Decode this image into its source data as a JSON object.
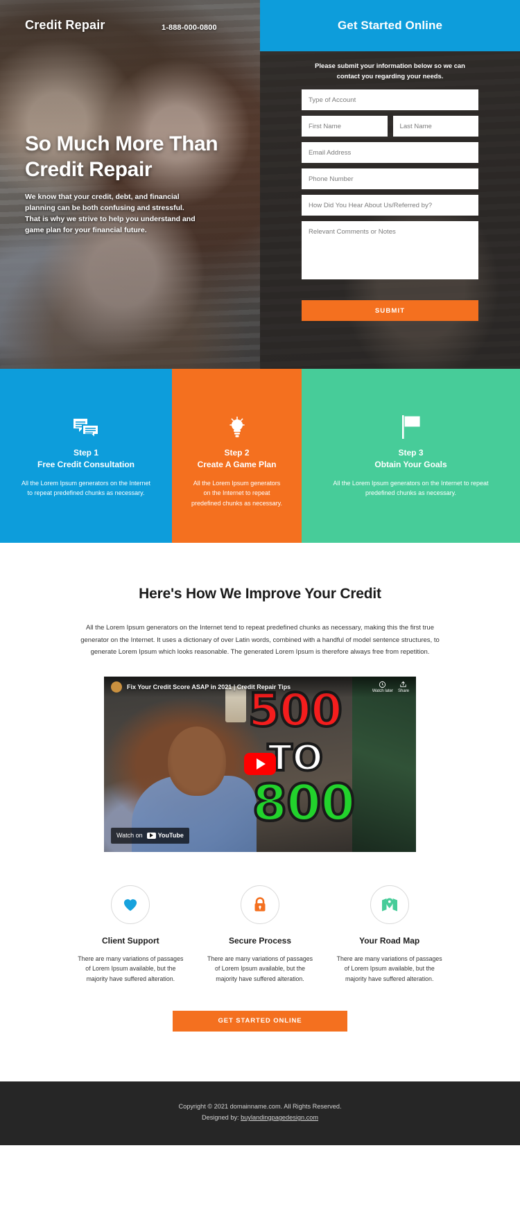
{
  "hero": {
    "brand": "Credit Repair",
    "phone": "1-888-000-0800",
    "title_line1": "So Much More Than",
    "title_line2": "Credit Repair",
    "subtext": "We know that your credit, debt, and financial planning can be both confusing and stressful. That is why we strive to help you understand and game plan for your financial future."
  },
  "form": {
    "heading": "Get Started Online",
    "note": "Please submit your information below so we can contact you regarding your needs.",
    "fields": [
      {
        "name": "account-type",
        "placeholder": "Type of Account",
        "value": ""
      },
      {
        "name": "first-name",
        "placeholder": "First Name",
        "value": ""
      },
      {
        "name": "last-name",
        "placeholder": "Last Name",
        "value": ""
      },
      {
        "name": "email",
        "placeholder": "Email Address",
        "value": ""
      },
      {
        "name": "phone",
        "placeholder": "Phone Number",
        "value": ""
      },
      {
        "name": "referral",
        "placeholder": "How Did You Hear About Us/Referred by?",
        "value": ""
      },
      {
        "name": "comments",
        "placeholder": "Relevant Comments or Notes",
        "value": ""
      }
    ],
    "submit_label": "SUBMIT",
    "header_color": "#0d9ddb",
    "submit_color": "#f4701f"
  },
  "steps": [
    {
      "icon": "chat-bubbles-icon",
      "number": "Step 1",
      "title": "Free Credit Consultation",
      "desc": "All the Lorem Ipsum generators on the Internet to repeat predefined chunks as necessary.",
      "color": "#0d9ddb"
    },
    {
      "icon": "lightbulb-icon",
      "number": "Step 2",
      "title": "Create A Game Plan",
      "desc": "All the Lorem Ipsum generators on the Internet to repeat predefined chunks as necessary.",
      "color": "#f4701f"
    },
    {
      "icon": "flag-icon",
      "number": "Step 3",
      "title": "Obtain Your Goals",
      "desc": "All the Lorem Ipsum generators on the Internet to repeat predefined chunks as necessary.",
      "color": "#47cc99"
    }
  ],
  "improve": {
    "heading": "Here's How We Improve Your Credit",
    "paragraph": "All the Lorem Ipsum generators on the Internet tend to repeat predefined chunks as necessary, making this the first true generator on the Internet. It uses a dictionary of over Latin words, combined with a handful of model sentence structures, to generate Lorem Ipsum which looks reasonable. The generated Lorem Ipsum is therefore always free from repetition."
  },
  "video": {
    "title": "Fix Your Credit Score ASAP in 2021 | Credit Repair Tips",
    "watch_later": "Watch later",
    "share": "Share",
    "watch_on": "Watch on",
    "provider": "YouTube",
    "big_text_1": "500",
    "big_text_2": "TO",
    "big_text_3": "800"
  },
  "features": [
    {
      "icon": "heart-icon",
      "title": "Client Support",
      "desc": "There are many variations of passages of Lorem Ipsum available, but the majority have suffered alteration.",
      "color": "#17a2dd"
    },
    {
      "icon": "lock-icon",
      "title": "Secure Process",
      "desc": "There are many variations of passages of Lorem Ipsum available, but the majority have suffered alteration.",
      "color": "#f4701f"
    },
    {
      "icon": "map-pin-icon",
      "title": "Your Road Map",
      "desc": "There are many variations of passages of Lorem Ipsum available, but the majority have suffered alteration.",
      "color": "#47cc99"
    }
  ],
  "cta": {
    "label": "GET STARTED ONLINE"
  },
  "footer": {
    "line1": "Copyright © 2021 domainname.com. All Rights Reserved.",
    "line2_prefix": "Designed by: ",
    "line2_link": "buylandingpagedesign.com"
  }
}
